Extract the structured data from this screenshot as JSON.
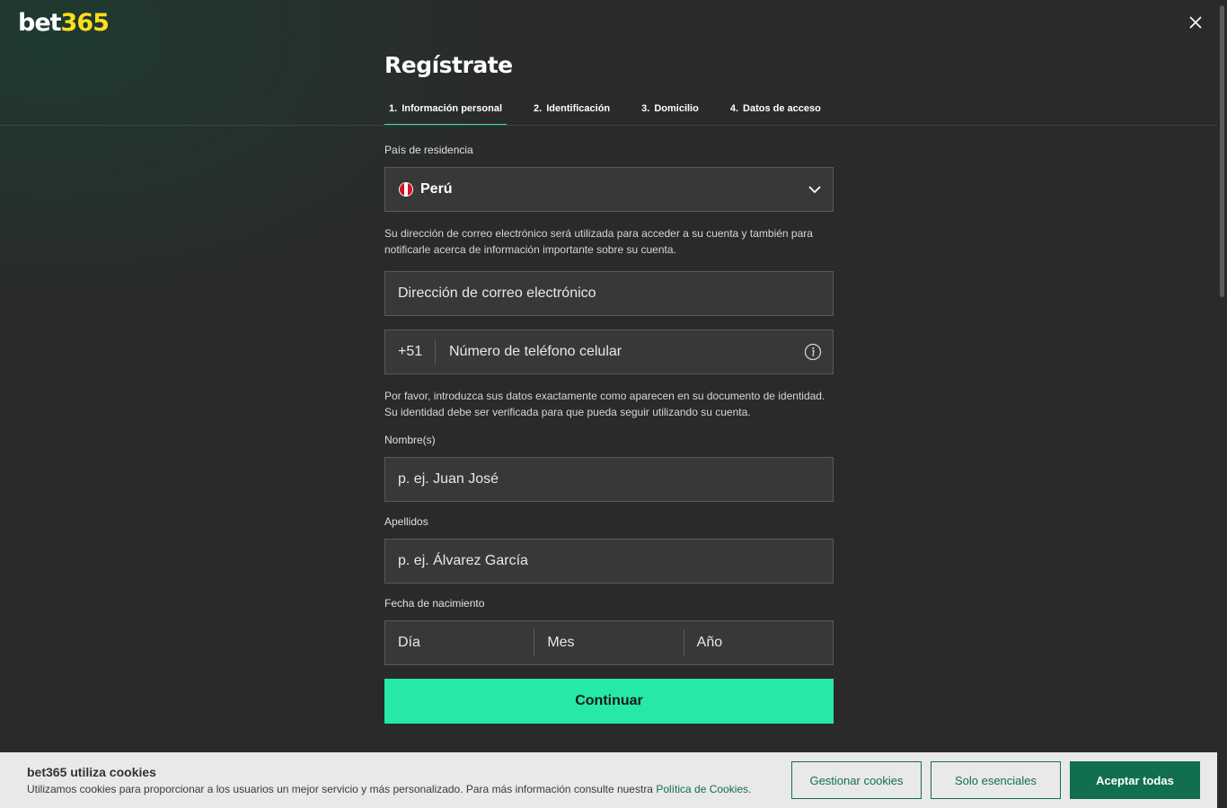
{
  "brand": {
    "logo_part1": "bet",
    "logo_part2": "365",
    "logo_accent": "#ffdf1b"
  },
  "header": {
    "title": "Regístrate",
    "close_icon": "close-icon"
  },
  "tabs": [
    {
      "num": "1.",
      "label": "Información personal",
      "active": true
    },
    {
      "num": "2.",
      "label": "Identificación"
    },
    {
      "num": "3.",
      "label": "Domicilio"
    },
    {
      "num": "4.",
      "label": "Datos de acceso"
    }
  ],
  "form": {
    "country_label": "País de residencia",
    "country_value": "Perú",
    "email_help": "Su dirección de correo electrónico será utilizada para acceder a su cuenta y también para notificarle acerca de información importante sobre su cuenta.",
    "email_placeholder": "Dirección de correo electrónico",
    "phone_code": "+51",
    "phone_placeholder": "Número de teléfono celular",
    "identity_help": "Por favor, introduzca sus datos exactamente como aparecen en su documento de identidad. Su identidad debe ser verificada para que pueda seguir utilizando su cuenta.",
    "first_name_label": "Nombre(s)",
    "first_name_placeholder": "p. ej. Juan José",
    "last_name_label": "Apellidos",
    "last_name_placeholder": "p. ej. Álvarez García",
    "dob_label": "Fecha de nacimiento",
    "dob_day": "Día",
    "dob_month": "Mes",
    "dob_year": "Año",
    "continue_label": "Continuar"
  },
  "cookies": {
    "title": "bet365 utiliza cookies",
    "text": "Utilizamos cookies para proporcionar a los usuarios un mejor servicio y más personalizado. Para más información consulte nuestra ",
    "link": "Política de Cookies",
    "suffix": ".",
    "manage_label": "Gestionar cookies",
    "essential_label": "Solo esenciales",
    "accept_label": "Aceptar todas"
  },
  "colors": {
    "accent": "#26e8a8",
    "cookie_green": "#126e51",
    "background": "#2a2a2a"
  }
}
